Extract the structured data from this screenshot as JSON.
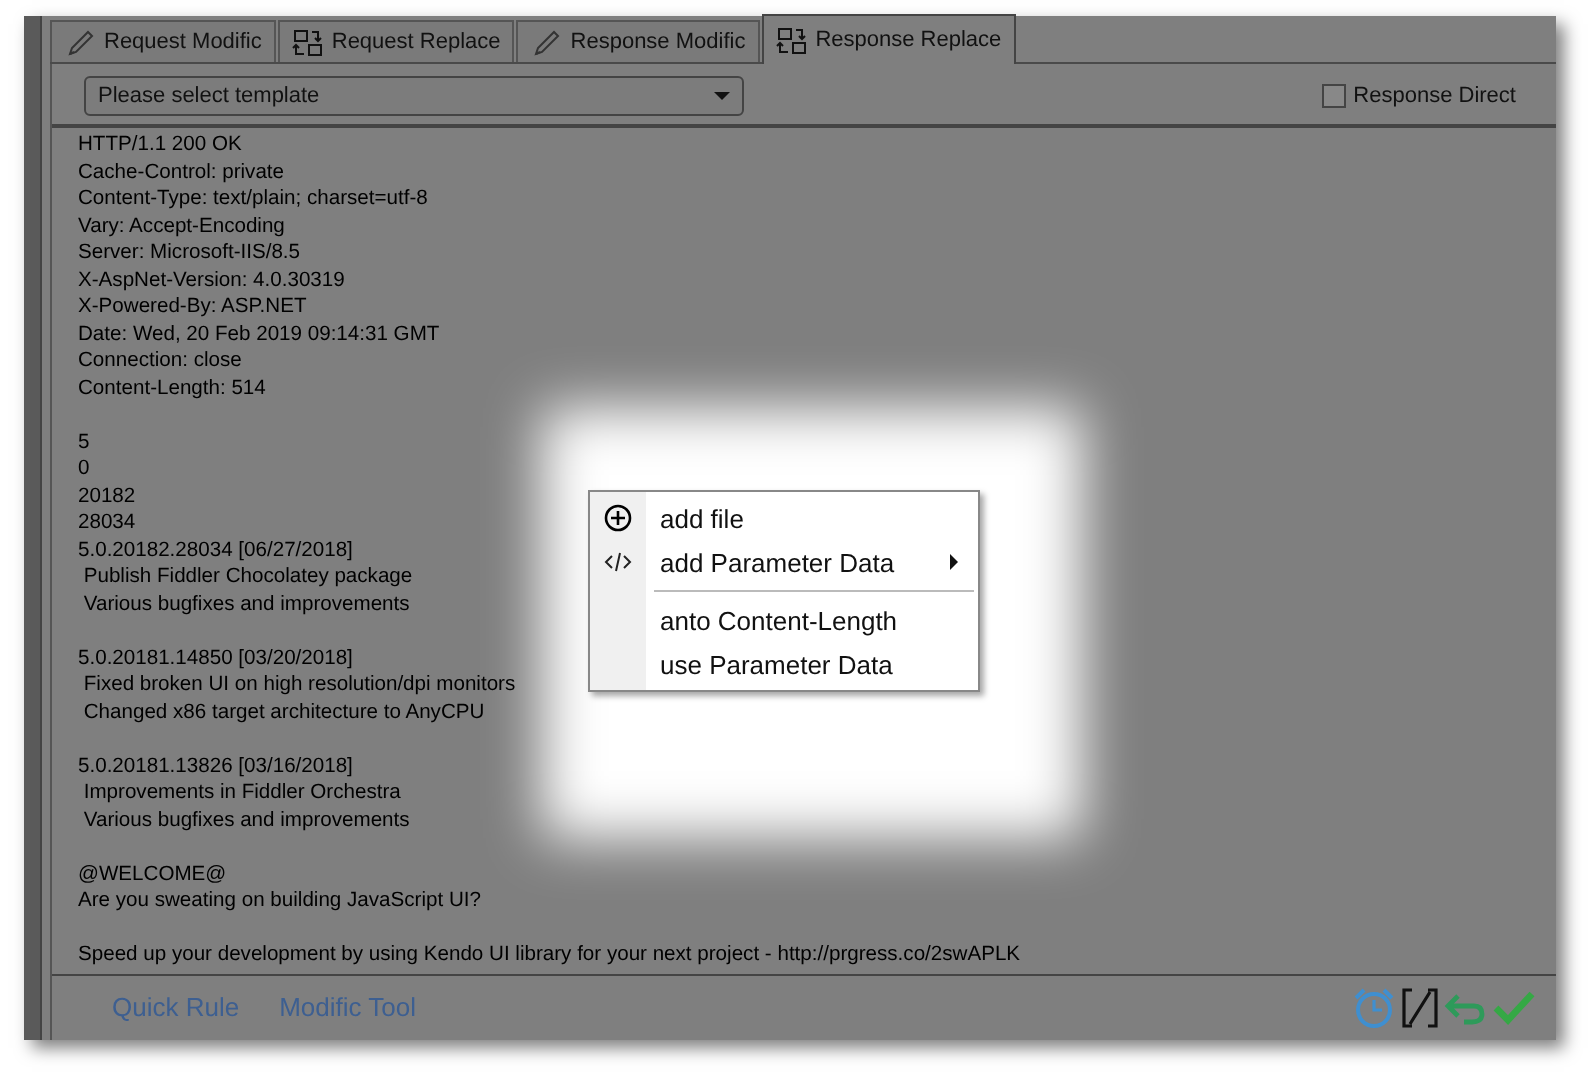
{
  "tabs": [
    {
      "label": "Request Modific",
      "kind": "modify",
      "selected": false
    },
    {
      "label": "Request Replace",
      "kind": "replace",
      "selected": false
    },
    {
      "label": "Response Modific",
      "kind": "modify",
      "selected": false
    },
    {
      "label": "Response Replace",
      "kind": "replace",
      "selected": true
    }
  ],
  "template_select": {
    "value": "Please select template"
  },
  "response_direct": {
    "label": "Response Direct",
    "checked": false
  },
  "editor": {
    "paragraphs": [
      [
        "HTTP/1.1 200 OK",
        "Cache-Control: private",
        "Content-Type: text/plain; charset=utf-8",
        "Vary: Accept-Encoding",
        "Server: Microsoft-IIS/8.5",
        "X-AspNet-Version: 4.0.30319",
        "X-Powered-By: ASP.NET",
        "Date: Wed, 20 Feb 2019 09:14:31 GMT",
        "Connection: close",
        "Content-Length: 514"
      ],
      [
        "5",
        "0",
        "20182",
        "28034",
        "5.0.20182.28034 [06/27/2018]",
        " Publish Fiddler Chocolatey package",
        " Various bugfixes and improvements"
      ],
      [
        "5.0.20181.14850 [03/20/2018]",
        " Fixed broken UI on high resolution/dpi monitors",
        " Changed x86 target architecture to AnyCPU"
      ],
      [
        "5.0.20181.13826 [03/16/2018]",
        " Improvements in Fiddler Orchestra",
        " Various bugfixes and improvements"
      ],
      [
        "@WELCOME@",
        "Are you sweating on building JavaScript UI?"
      ],
      [
        "Speed up your development by using Kendo UI library for your next project - http://prgress.co/2swAPLK"
      ]
    ]
  },
  "context_menu": {
    "items": [
      {
        "label": "add file",
        "kind": "add",
        "submenu": false
      },
      {
        "label": "add Parameter Data",
        "kind": "code",
        "submenu": true
      },
      {
        "label": "anto Content-Length",
        "kind": "plain",
        "submenu": false,
        "separator_before": true
      },
      {
        "label": "use Parameter Data",
        "kind": "plain",
        "submenu": false
      }
    ]
  },
  "footer_links": [
    "Quick Rule",
    "Modific Tool"
  ]
}
